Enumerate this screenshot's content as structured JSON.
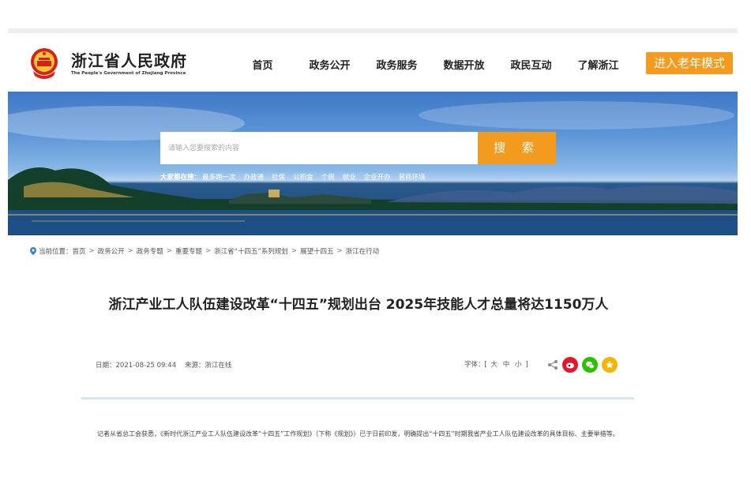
{
  "header": {
    "site_name": "浙江省人民政府",
    "site_name_en": "The People's Government of Zhejiang Province",
    "nav": [
      "首页",
      "政务公开",
      "政务服务",
      "数据开放",
      "政民互动",
      "了解浙江"
    ],
    "elder_mode": "进入老年模式"
  },
  "banner": {
    "search_placeholder": "请输入您要搜索的内容",
    "search_button": "搜 索",
    "hot_label": "大家都在搜：",
    "hot_links": [
      "最多跑一次",
      "办政通",
      "社保",
      "公积金",
      "个税",
      "就业",
      "企业开办",
      "营商环境"
    ]
  },
  "breadcrumb": {
    "label": "当前位置：",
    "items": [
      "首页",
      "政务公开",
      "政务专题",
      "重要专题",
      "浙江省“十四五”系列规划",
      "展望十四五",
      "浙江在行动"
    ]
  },
  "article": {
    "title": "浙江产业工人队伍建设改革“十四五”规划出台 2025年技能人才总量将达1150万人",
    "date": "日期：2021-08-25 09:44",
    "source": "来源：浙江在线",
    "font_label": "字体：[",
    "font_sizes": [
      "大",
      "中",
      "小"
    ],
    "font_close": "]",
    "paragraph": "记者从省总工会获悉，《新时代浙江产业工人队伍建设改革“十四五”工作规划》（下称《规划》）已于日前印发，明确提出“十四五”时期我省产业工人队伍建设改革的具体目标、主要举措等。"
  },
  "share": {
    "icons": [
      "share-icon",
      "weibo-icon",
      "wechat-icon",
      "favorite-icon"
    ],
    "colors": {
      "weibo": "#e6162d",
      "wechat": "#2dc100",
      "favorite": "#f4b400"
    }
  },
  "colors": {
    "accent": "#f29b1e",
    "divider": "#d7e6f5"
  }
}
